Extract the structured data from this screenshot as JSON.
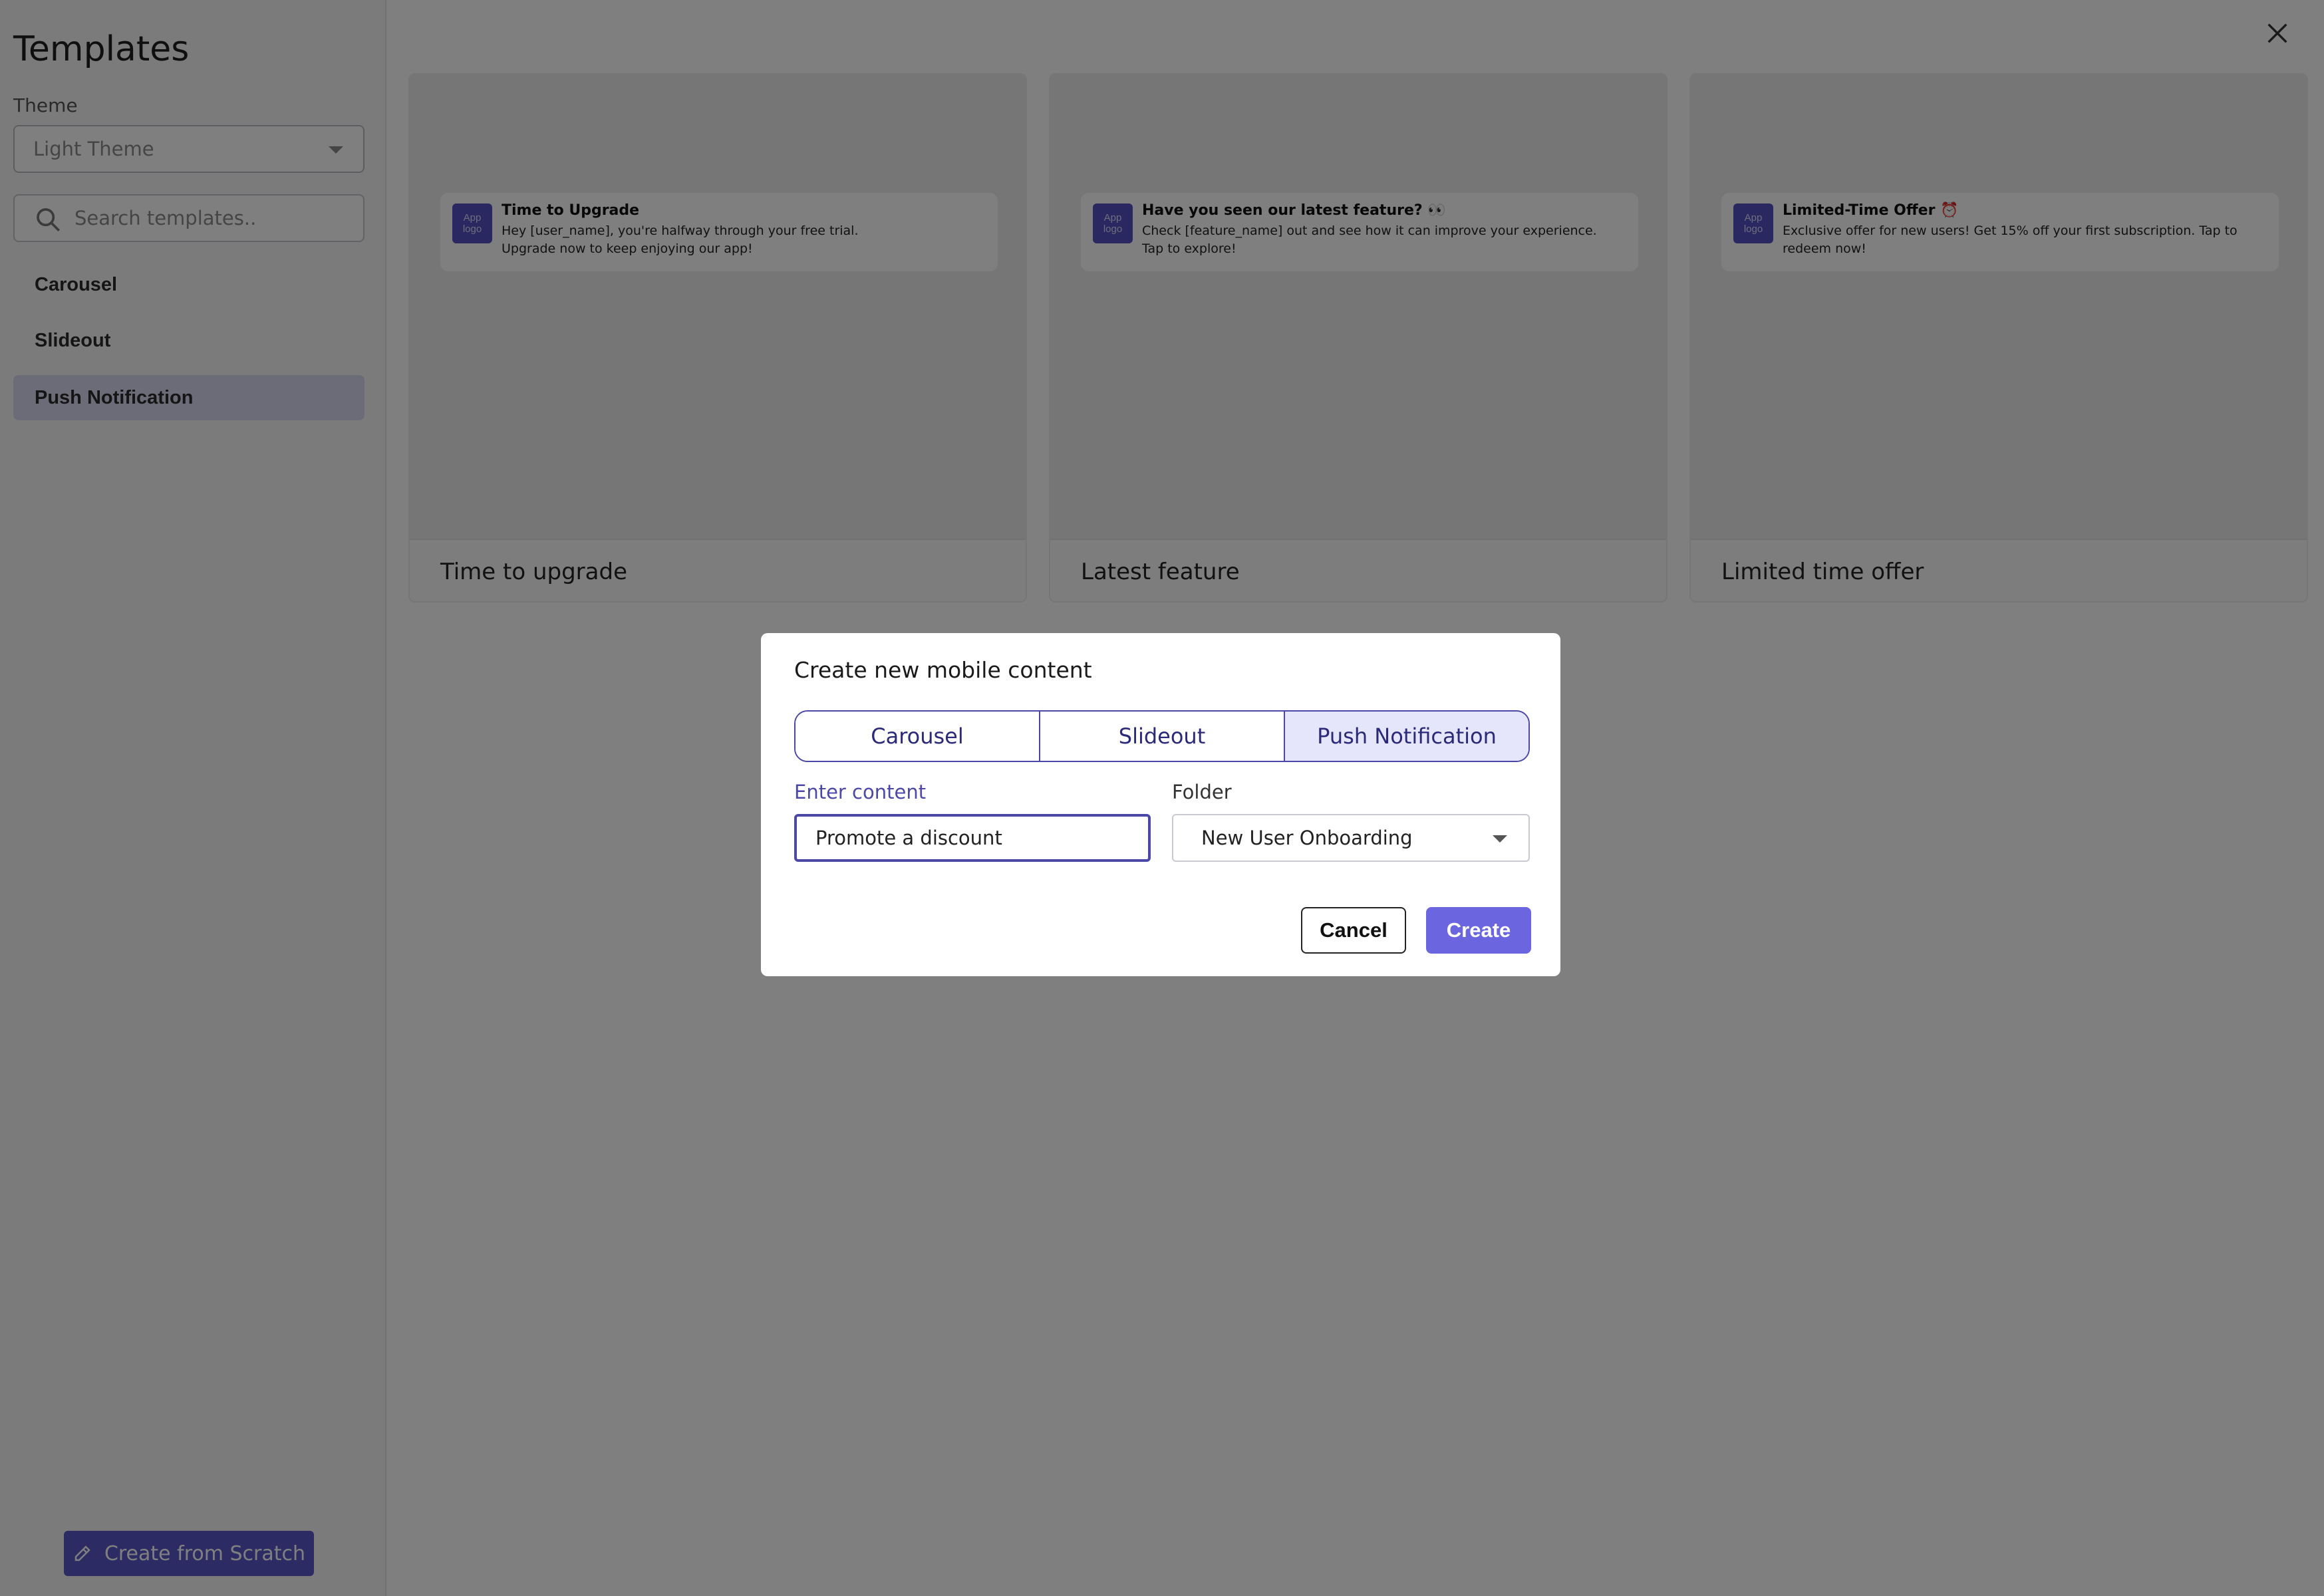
{
  "sidebar": {
    "title": "Templates",
    "theme_label": "Theme",
    "theme_value": "Light Theme",
    "search_placeholder": "Search templates..",
    "items": [
      {
        "label": "Carousel",
        "active": false
      },
      {
        "label": "Slideout",
        "active": false
      },
      {
        "label": "Push Notification",
        "active": true
      }
    ],
    "create_scratch_label": "Create from Scratch"
  },
  "templates": [
    {
      "caption": "Time to upgrade",
      "notification": {
        "logo_line1": "App",
        "logo_line2": "logo",
        "title": "Time to Upgrade",
        "body": "Hey [user_name], you're halfway through your free trial. Upgrade now to keep enjoying our app!"
      }
    },
    {
      "caption": "Latest feature",
      "notification": {
        "logo_line1": "App",
        "logo_line2": "logo",
        "title": "Have you seen our latest feature? 👀",
        "body": "Check [feature_name] out and see how it can improve your experience. Tap to explore!"
      }
    },
    {
      "caption": "Limited time offer",
      "notification": {
        "logo_line1": "App",
        "logo_line2": "logo",
        "title": "Limited-Time Offer ⏰",
        "body": "Exclusive offer for new users! Get 15% off your first subscription. Tap to redeem now!"
      }
    }
  ],
  "modal": {
    "title": "Create new mobile content",
    "tabs": [
      {
        "label": "Carousel",
        "active": false
      },
      {
        "label": "Slideout",
        "active": false
      },
      {
        "label": "Push Notification",
        "active": true
      }
    ],
    "content_label": "Enter content",
    "content_value": "Promote a discount",
    "folder_label": "Folder",
    "folder_value": "New User Onboarding",
    "cancel_label": "Cancel",
    "create_label": "Create"
  },
  "icons": {
    "close": "close-icon",
    "search": "search-icon",
    "pencil": "pencil-icon",
    "caret": "chevron-down-icon"
  },
  "colors": {
    "accent": "#5b57c9",
    "primary_button": "#6b66e0",
    "active_nav": "#d9d9f3",
    "focus_border": "#4b48a8"
  }
}
